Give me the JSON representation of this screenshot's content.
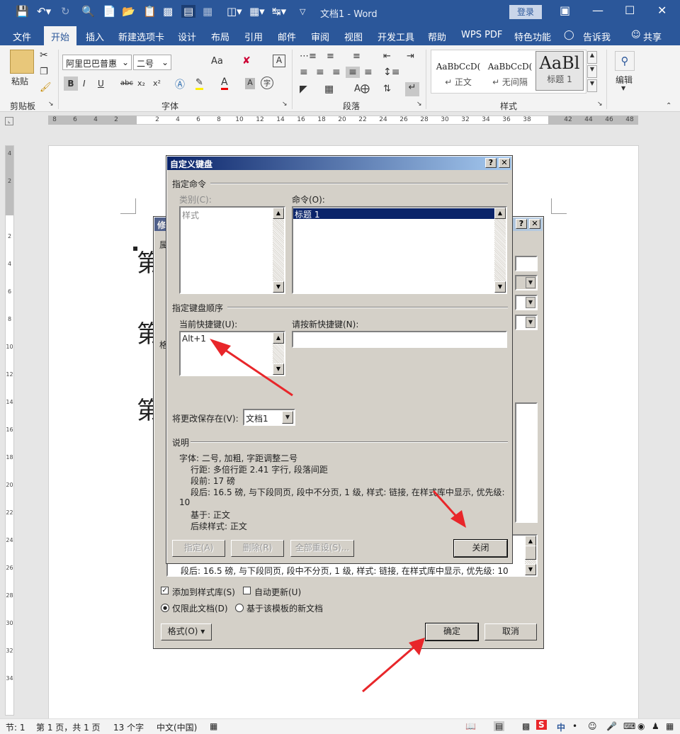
{
  "titlebar": {
    "doc_title": "文档1 - Word",
    "login": "登录"
  },
  "tabs": [
    "文件",
    "开始",
    "插入",
    "新建选项卡",
    "设计",
    "布局",
    "引用",
    "邮件",
    "审阅",
    "视图",
    "开发工具",
    "帮助",
    "WPS PDF",
    "特色功能",
    "告诉我",
    "共享"
  ],
  "ribbon": {
    "clipboard": {
      "label": "剪贴板",
      "paste": "粘贴"
    },
    "font": {
      "label": "字体",
      "font_name": "阿里巴巴普惠",
      "font_size": "二号",
      "grow_label": "Aa",
      "bold": "B",
      "italic": "I",
      "underline": "U",
      "strike": "abc",
      "sub": "x₂",
      "sup": "x²"
    },
    "paragraph": {
      "label": "段落"
    },
    "styles": {
      "label": "样式",
      "items": [
        {
          "sample": "AaBbCcD(",
          "name": "↵ 正文"
        },
        {
          "sample": "AaBbCcD(",
          "name": "↵ 无间隔"
        },
        {
          "sample": "AaBl",
          "name": "标题 1"
        }
      ]
    },
    "editing": {
      "label": "编辑"
    }
  },
  "ruler": {
    "h_ticks": [
      "8",
      "6",
      "4",
      "2",
      "",
      "2",
      "4",
      "6",
      "8",
      "10",
      "12",
      "14",
      "16",
      "18",
      "20",
      "22",
      "24",
      "26",
      "28",
      "30",
      "32",
      "34",
      "36",
      "38",
      "",
      "42",
      "44",
      "46",
      "48"
    ],
    "v_ticks": [
      "4",
      "2",
      "",
      "2",
      "4",
      "6",
      "8",
      "10",
      "12",
      "14",
      "16",
      "18",
      "20",
      "22",
      "24",
      "26",
      "28",
      "30",
      "32",
      "34"
    ]
  },
  "document": {
    "line1": "第",
    "line2": "第",
    "line3": "第"
  },
  "status": {
    "section": "节: 1",
    "pages": "第 1 页，共 1 页",
    "words": "13 个字",
    "lang": "中文(中国)"
  },
  "modify_dialog": {
    "title": "修",
    "prop_label": "属",
    "format_label": "格",
    "desc_text": "段后: 16.5 磅, 与下段同页, 段中不分页, 1 级, 样式: 链接, 在样式库中显示, 优先级: 10",
    "add_to_gallery": "添加到样式库(S)",
    "auto_update": "自动更新(U)",
    "only_this_doc": "仅限此文档(D)",
    "new_docs_template": "基于该模板的新文档",
    "format_btn": "格式(O) ▾",
    "ok_btn": "确定",
    "cancel_btn": "取消"
  },
  "keyboard_dialog": {
    "title": "自定义键盘",
    "section_command": "指定命令",
    "category_label": "类别(C):",
    "category_items": [
      "样式"
    ],
    "command_label": "命令(O):",
    "command_items": [
      "标题 1"
    ],
    "section_keys": "指定键盘顺序",
    "current_keys_label": "当前快捷键(U):",
    "current_keys": [
      "Alt+1"
    ],
    "new_key_label": "请按新快捷键(N):",
    "new_key_value": "",
    "save_in_label": "将更改保存在(V):",
    "save_in_value": "文档1",
    "desc_label": "说明",
    "desc_lines": [
      "字体: 二号, 加粗, 字距调整二号",
      "行距: 多倍行距 2.41 字行, 段落间距",
      "段前: 17 磅",
      "段后: 16.5 磅, 与下段同页, 段中不分页, 1 级, 样式: 链接, 在样式库中显示, 优先级:",
      "10",
      "基于: 正文",
      "后续样式: 正文"
    ],
    "assign_btn": "指定(A)",
    "remove_btn": "删除(R)",
    "reset_all_btn": "全部重设(S)...",
    "close_btn": "关闭"
  },
  "colors": {
    "word_blue": "#2b579a",
    "dialog_bg": "#d4d0c8",
    "highlight": "#0a246a",
    "arrow": "#e8262a"
  }
}
